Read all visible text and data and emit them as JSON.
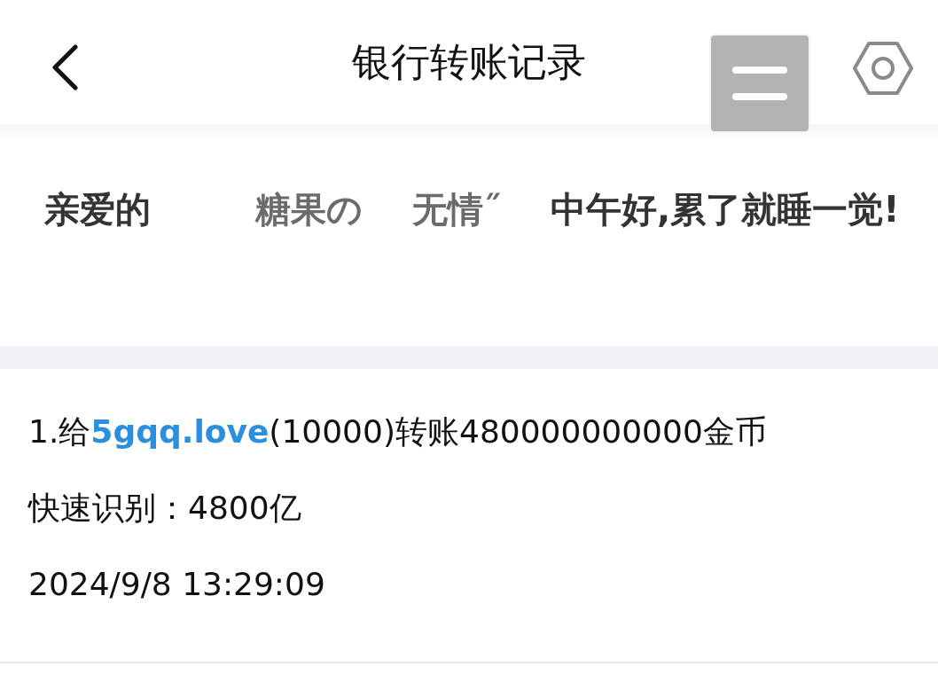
{
  "header": {
    "title": "银行转账记录"
  },
  "greeting": [
    {
      "kind": "text",
      "text": "亲爱的"
    },
    {
      "kind": "name",
      "text": "糖果の"
    },
    {
      "kind": "name",
      "text": "无情˝"
    },
    {
      "kind": "text",
      "text": "中午好,累了就睡一觉!"
    }
  ],
  "records": [
    {
      "line": [
        {
          "kind": "text",
          "text": "1.给"
        },
        {
          "kind": "link",
          "text": "5gqq.love"
        },
        {
          "kind": "text",
          "text": "(10000)转账480000000000金币"
        }
      ],
      "quick": "快速识别：4800亿",
      "time": "2024/9/8 13:29:09"
    }
  ]
}
